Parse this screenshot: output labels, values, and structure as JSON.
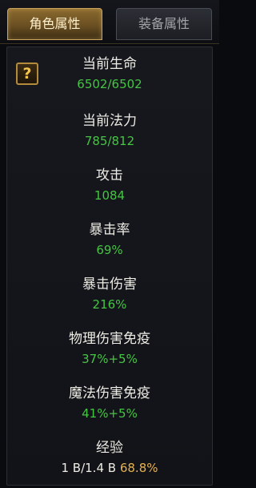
{
  "tabs": {
    "character": "角色属性",
    "equipment": "装备属性"
  },
  "help": {
    "symbol": "?"
  },
  "stats": {
    "hp": {
      "label": "当前生命",
      "value": "6502/6502"
    },
    "mp": {
      "label": "当前法力",
      "value": "785/812"
    },
    "attack": {
      "label": "攻击",
      "value": "1084"
    },
    "crit_rate": {
      "label": "暴击率",
      "value": "69%"
    },
    "crit_damage": {
      "label": "暴击伤害",
      "value": "216%"
    },
    "phys_immunity": {
      "label": "物理伤害免疫",
      "value": "37%+5%"
    },
    "magic_immunity": {
      "label": "魔法伤害免疫",
      "value": "41%+5%"
    },
    "experience": {
      "label": "经验",
      "progress": "1 B/1.4 B",
      "percent": "68.8%"
    }
  },
  "colors": {
    "value_green": "#46c443",
    "exp_gold": "#e6b24f",
    "tab_gold_border": "#c9a35a",
    "background": "#0a0b0e"
  }
}
